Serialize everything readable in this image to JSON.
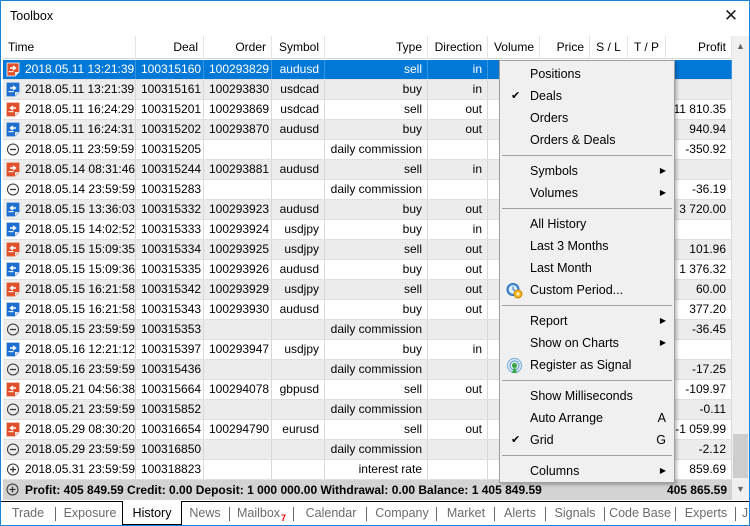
{
  "window": {
    "title": "Toolbox",
    "close_label": "✕"
  },
  "columns": [
    {
      "key": "time",
      "label": "Time"
    },
    {
      "key": "deal",
      "label": "Deal"
    },
    {
      "key": "order",
      "label": "Order"
    },
    {
      "key": "symbol",
      "label": "Symbol"
    },
    {
      "key": "type",
      "label": "Type"
    },
    {
      "key": "direction",
      "label": "Direction"
    },
    {
      "key": "volume",
      "label": "Volume"
    },
    {
      "key": "price",
      "label": "Price"
    },
    {
      "key": "sl",
      "label": "S / L"
    },
    {
      "key": "tp",
      "label": "T / P"
    },
    {
      "key": "profit",
      "label": "Profit"
    }
  ],
  "rows": [
    {
      "icon": "sell-in",
      "time": "2018.05.11 13:21:39",
      "deal": "100315160",
      "order": "100293829",
      "symbol": "audusd",
      "type": "sell",
      "direction": "in",
      "profit": "",
      "selected": true
    },
    {
      "icon": "buy-in",
      "time": "2018.05.11 13:21:39",
      "deal": "100315161",
      "order": "100293830",
      "symbol": "usdcad",
      "type": "buy",
      "direction": "in",
      "profit": ""
    },
    {
      "icon": "sell-out",
      "time": "2018.05.11 16:24:29",
      "deal": "100315201",
      "order": "100293869",
      "symbol": "usdcad",
      "type": "sell",
      "direction": "out",
      "profit": "11 810.35"
    },
    {
      "icon": "buy-out",
      "time": "2018.05.11 16:24:31",
      "deal": "100315202",
      "order": "100293870",
      "symbol": "audusd",
      "type": "buy",
      "direction": "out",
      "profit": "940.94"
    },
    {
      "icon": "minus",
      "time": "2018.05.11 23:59:59",
      "deal": "100315205",
      "order": "",
      "symbol": "",
      "type": "daily commission",
      "direction": "",
      "profit": "-350.92"
    },
    {
      "icon": "sell-in",
      "time": "2018.05.14 08:31:46",
      "deal": "100315244",
      "order": "100293881",
      "symbol": "audusd",
      "type": "sell",
      "direction": "in",
      "profit": ""
    },
    {
      "icon": "minus",
      "time": "2018.05.14 23:59:59",
      "deal": "100315283",
      "order": "",
      "symbol": "",
      "type": "daily commission",
      "direction": "",
      "profit": "-36.19"
    },
    {
      "icon": "buy-out",
      "time": "2018.05.15 13:36:03",
      "deal": "100315332",
      "order": "100293923",
      "symbol": "audusd",
      "type": "buy",
      "direction": "out",
      "profit": "3 720.00"
    },
    {
      "icon": "buy-in",
      "time": "2018.05.15 14:02:52",
      "deal": "100315333",
      "order": "100293924",
      "symbol": "usdjpy",
      "type": "buy",
      "direction": "in",
      "profit": ""
    },
    {
      "icon": "sell-out",
      "time": "2018.05.15 15:09:35",
      "deal": "100315334",
      "order": "100293925",
      "symbol": "usdjpy",
      "type": "sell",
      "direction": "out",
      "profit": "101.96"
    },
    {
      "icon": "buy-out",
      "time": "2018.05.15 15:09:36",
      "deal": "100315335",
      "order": "100293926",
      "symbol": "audusd",
      "type": "buy",
      "direction": "out",
      "profit": "1 376.32"
    },
    {
      "icon": "sell-out",
      "time": "2018.05.15 16:21:58",
      "deal": "100315342",
      "order": "100293929",
      "symbol": "usdjpy",
      "type": "sell",
      "direction": "out",
      "profit": "60.00"
    },
    {
      "icon": "buy-out",
      "time": "2018.05.15 16:21:58",
      "deal": "100315343",
      "order": "100293930",
      "symbol": "audusd",
      "type": "buy",
      "direction": "out",
      "profit": "377.20"
    },
    {
      "icon": "minus",
      "time": "2018.05.15 23:59:59",
      "deal": "100315353",
      "order": "",
      "symbol": "",
      "type": "daily commission",
      "direction": "",
      "profit": "-36.45"
    },
    {
      "icon": "buy-in",
      "time": "2018.05.16 12:21:12",
      "deal": "100315397",
      "order": "100293947",
      "symbol": "usdjpy",
      "type": "buy",
      "direction": "in",
      "profit": ""
    },
    {
      "icon": "minus",
      "time": "2018.05.16 23:59:59",
      "deal": "100315436",
      "order": "",
      "symbol": "",
      "type": "daily commission",
      "direction": "",
      "profit": "-17.25"
    },
    {
      "icon": "sell-out",
      "time": "2018.05.21 04:56:38",
      "deal": "100315664",
      "order": "100294078",
      "symbol": "gbpusd",
      "type": "sell",
      "direction": "out",
      "profit": "-109.97"
    },
    {
      "icon": "minus",
      "time": "2018.05.21 23:59:59",
      "deal": "100315852",
      "order": "",
      "symbol": "",
      "type": "daily commission",
      "direction": "",
      "profit": "-0.11"
    },
    {
      "icon": "sell-out",
      "time": "2018.05.29 08:30:20",
      "deal": "100316654",
      "order": "100294790",
      "symbol": "eurusd",
      "type": "sell",
      "direction": "out",
      "profit": "-1 059.99"
    },
    {
      "icon": "minus",
      "time": "2018.05.29 23:59:59",
      "deal": "100316850",
      "order": "",
      "symbol": "",
      "type": "daily commission",
      "direction": "",
      "profit": "-2.12"
    },
    {
      "icon": "plus",
      "time": "2018.05.31 23:59:59",
      "deal": "100318823",
      "order": "",
      "symbol": "",
      "type": "interest rate",
      "direction": "",
      "profit": "859.69"
    }
  ],
  "summary": {
    "text": "Profit: 405 849.59  Credit: 0.00  Deposit: 1 000 000.00  Withdrawal: 0.00  Balance: 1 405 849.59",
    "total": "405 865.59"
  },
  "context_menu": {
    "items": [
      {
        "label": "Positions",
        "checked": false
      },
      {
        "label": "Deals",
        "checked": true
      },
      {
        "label": "Orders",
        "checked": false
      },
      {
        "label": "Orders & Deals",
        "checked": false
      },
      {
        "separator": true
      },
      {
        "label": "Symbols",
        "submenu": true
      },
      {
        "label": "Volumes",
        "submenu": true
      },
      {
        "separator": true
      },
      {
        "label": "All History"
      },
      {
        "label": "Last 3 Months"
      },
      {
        "label": "Last Month"
      },
      {
        "label": "Custom Period...",
        "icon": "calendar-gear-icon"
      },
      {
        "separator": true
      },
      {
        "label": "Report",
        "submenu": true
      },
      {
        "label": "Show on Charts",
        "submenu": true
      },
      {
        "label": "Register as Signal",
        "icon": "signal-icon"
      },
      {
        "separator": true
      },
      {
        "label": "Show Milliseconds"
      },
      {
        "label": "Auto Arrange",
        "shortcut": "A"
      },
      {
        "label": "Grid",
        "checked": true,
        "shortcut": "G"
      },
      {
        "separator": true
      },
      {
        "label": "Columns",
        "submenu": true
      }
    ]
  },
  "tabs": [
    {
      "label": "Trade"
    },
    {
      "label": "Exposure"
    },
    {
      "label": "History",
      "active": true
    },
    {
      "label": "News"
    },
    {
      "label": "Mailbox",
      "badge": "7"
    },
    {
      "label": "Calendar"
    },
    {
      "label": "Company"
    },
    {
      "label": "Market"
    },
    {
      "label": "Alerts"
    },
    {
      "label": "Signals"
    },
    {
      "label": "Code Base"
    },
    {
      "label": "Experts"
    },
    {
      "label": "J"
    }
  ],
  "colors": {
    "selection": "#0078d7",
    "sell_icon": "#e0502a",
    "buy_icon": "#1e6fd0",
    "window_border": "#1883d7",
    "badge": "#e00000"
  }
}
